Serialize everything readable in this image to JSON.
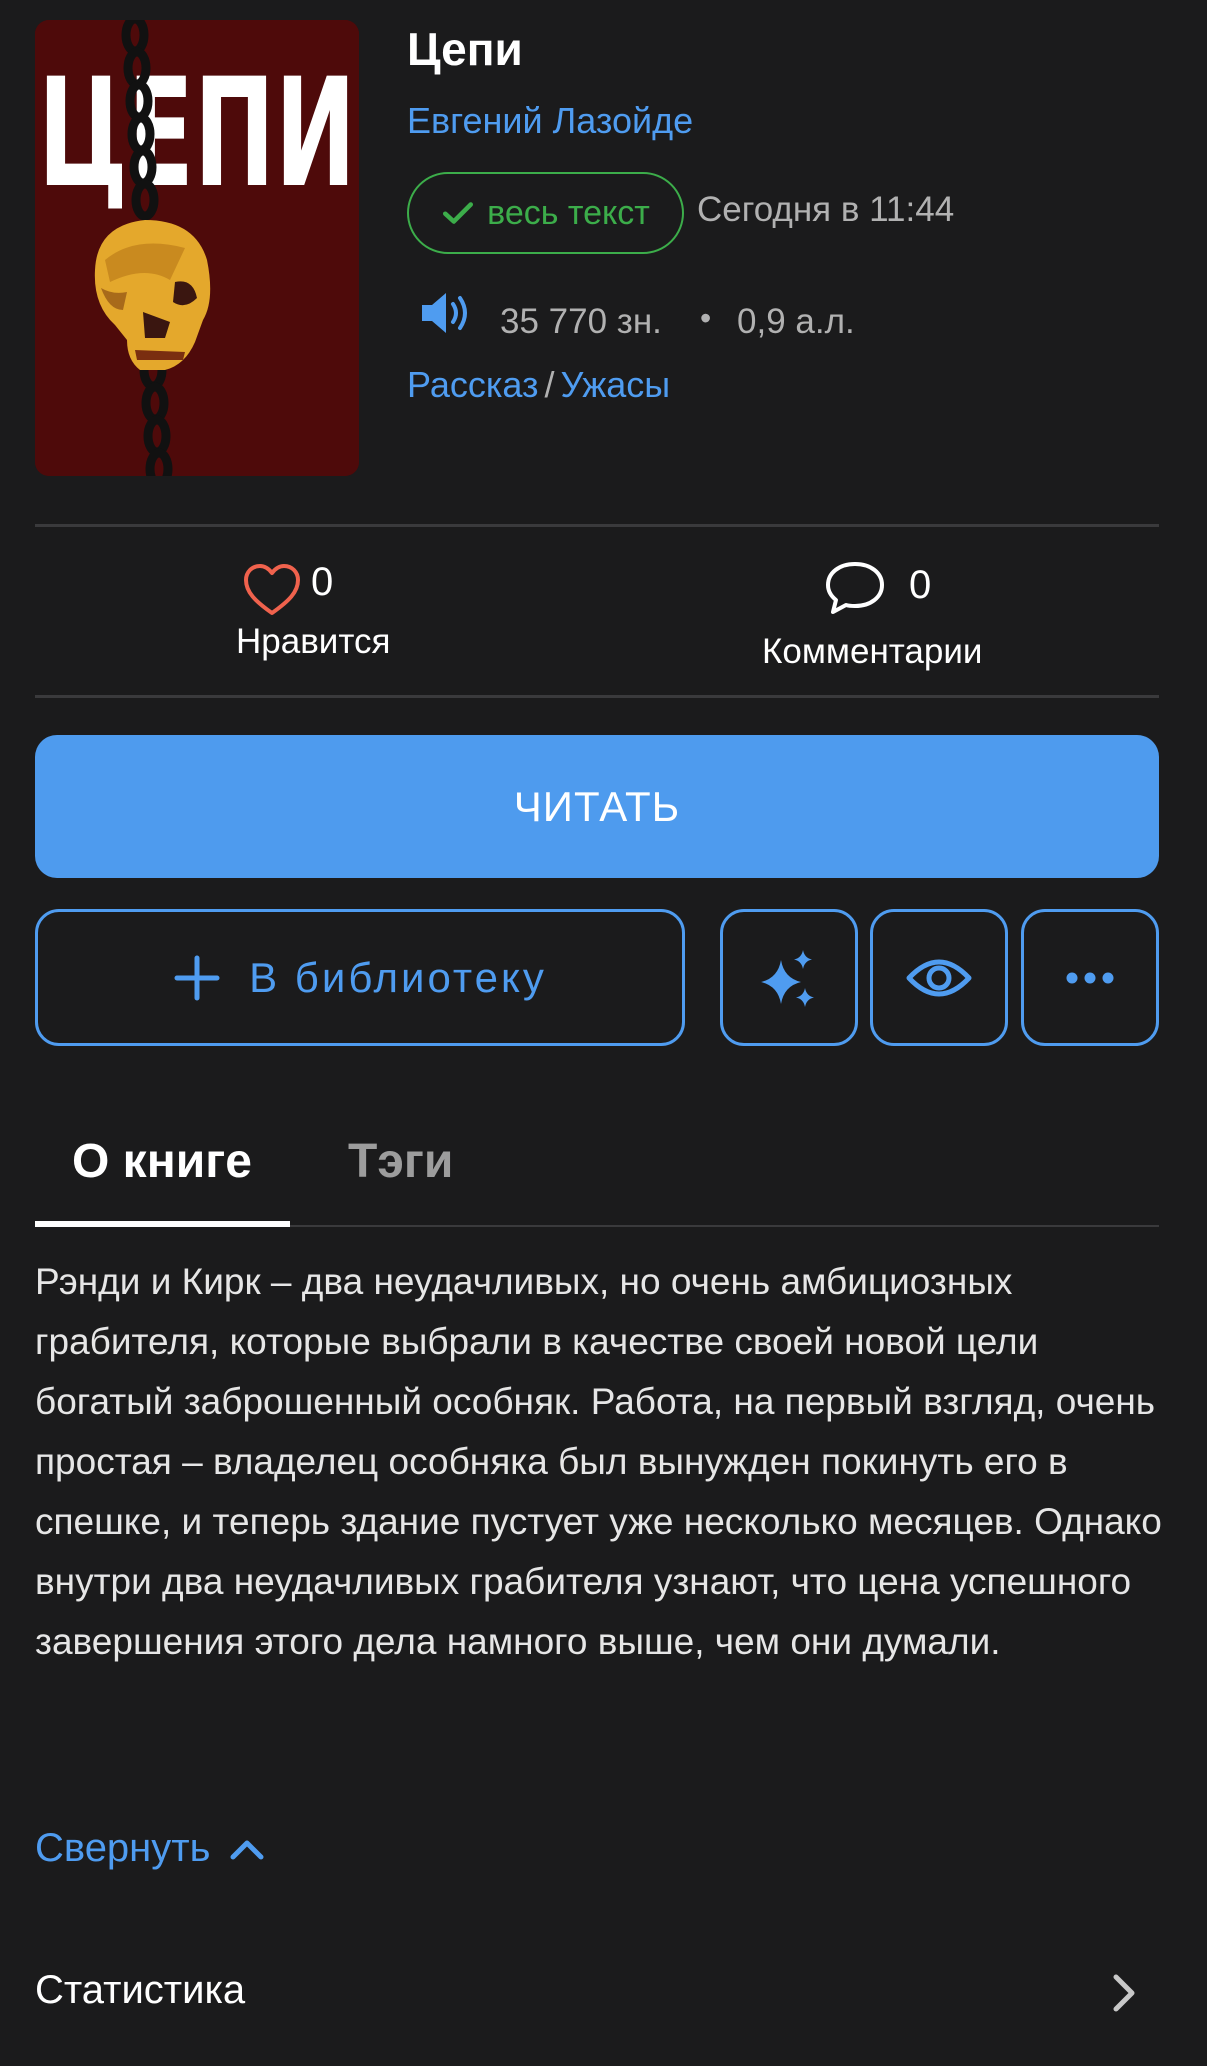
{
  "book": {
    "cover_text": "ЦЕПИ",
    "title": "Цепи",
    "author": "Евгений Лазойде",
    "status_badge": "весь текст",
    "updated": "Сегодня в 11:44",
    "characters": "35 770 зн.",
    "bullet": "•",
    "author_sheets": "0,9 а.л.",
    "genre": "Рассказ",
    "genre_separator": "/",
    "subgenre": "Ужасы"
  },
  "stats_row": {
    "likes_count": "0",
    "likes_label": "Нравится",
    "comments_count": "0",
    "comments_label": "Комментарии"
  },
  "actions": {
    "read_label": "ЧИТАТЬ",
    "library_label": "В библиотеку"
  },
  "tabs": [
    {
      "label": "О книге",
      "active": true
    },
    {
      "label": "Тэги",
      "active": false
    }
  ],
  "description": "Рэнди и Кирк – два неудачливых, но очень амбициозных грабителя, которые выбрали в качестве своей новой цели богатый заброшенный особняк. Работа, на первый взгляд, очень простая – владелец особняка был вынужден покинуть его в спешке, и теперь здание пустует уже несколько месяцев. Однако внутри два неудачливых грабителя узнают, что цена успешного завершения этого дела намного выше, чем они думали.",
  "collapse_label": "Свернуть",
  "statistics_label": "Статистика",
  "icons": {
    "audio": "speaker-icon",
    "like": "heart-icon",
    "comments": "speech-bubble-icon",
    "library": "plus-icon",
    "magic": "sparkles-icon",
    "watch": "eye-icon",
    "more": "more-dots-icon",
    "collapse": "chevron-up-icon",
    "statistics": "chevron-right-icon"
  },
  "colors": {
    "background": "#1b1b1c",
    "accent": "#4f9cf0",
    "read_button": "#4e9bee",
    "complete_badge": "#3cad4a",
    "heart": "#f0624d",
    "muted_text": "#b1b1b1"
  }
}
